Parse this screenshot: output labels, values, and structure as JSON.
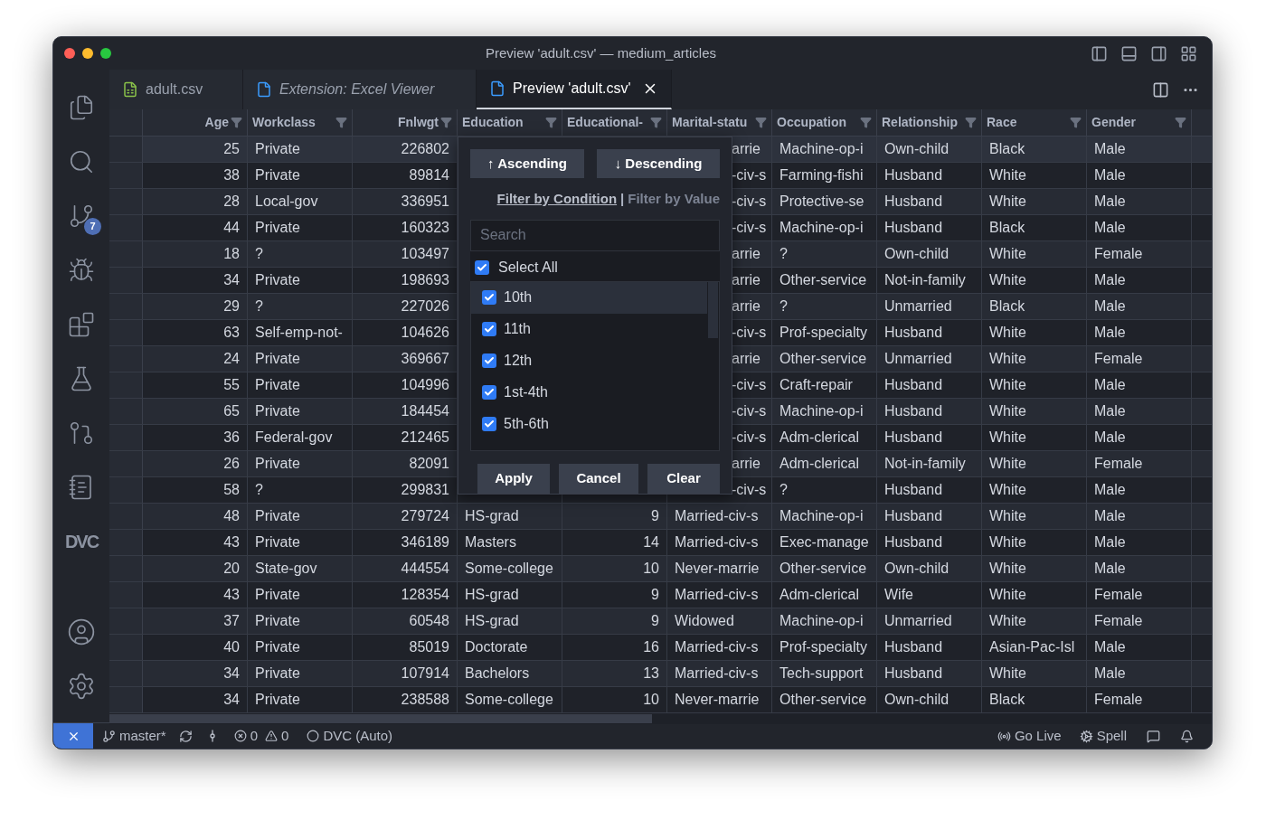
{
  "window": {
    "title": "Preview 'adult.csv' — medium_articles"
  },
  "activity_bar": {
    "source_control_badge": "7",
    "dvc_logo": "DVC"
  },
  "tabs": [
    {
      "label": "adult.csv",
      "kind": "spreadsheet",
      "italic": false,
      "selected": false
    },
    {
      "label": "Extension: Excel Viewer",
      "kind": "file",
      "italic": true,
      "selected": false
    },
    {
      "label": "Preview 'adult.csv'",
      "kind": "file",
      "italic": false,
      "selected": true
    }
  ],
  "grid": {
    "columns": [
      {
        "label": "Age",
        "numeric": true
      },
      {
        "label": "Workclass",
        "numeric": false
      },
      {
        "label": "Fnlwgt",
        "numeric": true
      },
      {
        "label": "Education",
        "numeric": false
      },
      {
        "label": "Educational-",
        "numeric": false
      },
      {
        "label": "Marital-statu",
        "numeric": false
      },
      {
        "label": "Occupation",
        "numeric": false
      },
      {
        "label": "Relationship",
        "numeric": false
      },
      {
        "label": "Race",
        "numeric": false
      },
      {
        "label": "Gender",
        "numeric": false
      }
    ],
    "rows": [
      {
        "selected": true,
        "covered": true,
        "cells": [
          "25",
          "Private",
          "226802",
          "arrie",
          "Machine-op-i",
          "Own-child",
          "Black",
          "Male"
        ]
      },
      {
        "selected": false,
        "covered": true,
        "cells": [
          "38",
          "Private",
          "89814",
          "-civ-s",
          "Farming-fishi",
          "Husband",
          "White",
          "Male"
        ]
      },
      {
        "selected": false,
        "covered": true,
        "cells": [
          "28",
          "Local-gov",
          "336951",
          "-civ-s",
          "Protective-se",
          "Husband",
          "White",
          "Male"
        ]
      },
      {
        "selected": false,
        "covered": true,
        "cells": [
          "44",
          "Private",
          "160323",
          "-civ-s",
          "Machine-op-i",
          "Husband",
          "Black",
          "Male"
        ]
      },
      {
        "selected": false,
        "covered": true,
        "cells": [
          "18",
          "?",
          "103497",
          "arrie",
          "?",
          "Own-child",
          "White",
          "Female"
        ]
      },
      {
        "selected": false,
        "covered": true,
        "cells": [
          "34",
          "Private",
          "198693",
          "arrie",
          "Other-service",
          "Not-in-family",
          "White",
          "Male"
        ]
      },
      {
        "selected": false,
        "covered": true,
        "cells": [
          "29",
          "?",
          "227026",
          "arrie",
          "?",
          "Unmarried",
          "Black",
          "Male"
        ]
      },
      {
        "selected": false,
        "covered": true,
        "cells": [
          "63",
          "Self-emp-not-",
          "104626",
          "-civ-s",
          "Prof-specialty",
          "Husband",
          "White",
          "Male"
        ]
      },
      {
        "selected": false,
        "covered": true,
        "cells": [
          "24",
          "Private",
          "369667",
          "arrie",
          "Other-service",
          "Unmarried",
          "White",
          "Female"
        ]
      },
      {
        "selected": false,
        "covered": true,
        "cells": [
          "55",
          "Private",
          "104996",
          "-civ-s",
          "Craft-repair",
          "Husband",
          "White",
          "Male"
        ]
      },
      {
        "selected": false,
        "covered": true,
        "cells": [
          "65",
          "Private",
          "184454",
          "-civ-s",
          "Machine-op-i",
          "Husband",
          "White",
          "Male"
        ]
      },
      {
        "selected": false,
        "covered": true,
        "cells": [
          "36",
          "Federal-gov",
          "212465",
          "-civ-s",
          "Adm-clerical",
          "Husband",
          "White",
          "Male"
        ]
      },
      {
        "selected": false,
        "covered": true,
        "cells": [
          "26",
          "Private",
          "82091",
          "arrie",
          "Adm-clerical",
          "Not-in-family",
          "White",
          "Female"
        ]
      },
      {
        "selected": false,
        "covered": true,
        "cells": [
          "58",
          "?",
          "299831",
          "-civ-s",
          "?",
          "Husband",
          "White",
          "Male"
        ]
      },
      {
        "selected": false,
        "covered": false,
        "cells": [
          "48",
          "Private",
          "279724",
          "HS-grad",
          "9",
          "Married-civ-s",
          "Machine-op-i",
          "Husband",
          "White",
          "Male"
        ]
      },
      {
        "selected": false,
        "covered": false,
        "cells": [
          "43",
          "Private",
          "346189",
          "Masters",
          "14",
          "Married-civ-s",
          "Exec-manage",
          "Husband",
          "White",
          "Male"
        ]
      },
      {
        "selected": false,
        "covered": false,
        "cells": [
          "20",
          "State-gov",
          "444554",
          "Some-college",
          "10",
          "Never-marrie",
          "Other-service",
          "Own-child",
          "White",
          "Male"
        ]
      },
      {
        "selected": false,
        "covered": false,
        "cells": [
          "43",
          "Private",
          "128354",
          "HS-grad",
          "9",
          "Married-civ-s",
          "Adm-clerical",
          "Wife",
          "White",
          "Female"
        ]
      },
      {
        "selected": false,
        "covered": false,
        "cells": [
          "37",
          "Private",
          "60548",
          "HS-grad",
          "9",
          "Widowed",
          "Machine-op-i",
          "Unmarried",
          "White",
          "Female"
        ]
      },
      {
        "selected": false,
        "covered": false,
        "cells": [
          "40",
          "Private",
          "85019",
          "Doctorate",
          "16",
          "Married-civ-s",
          "Prof-specialty",
          "Husband",
          "Asian-Pac-Isl",
          "Male"
        ]
      },
      {
        "selected": false,
        "covered": false,
        "cells": [
          "34",
          "Private",
          "107914",
          "Bachelors",
          "13",
          "Married-civ-s",
          "Tech-support",
          "Husband",
          "White",
          "Male"
        ]
      },
      {
        "selected": false,
        "covered": false,
        "cells": [
          "34",
          "Private",
          "238588",
          "Some-college",
          "10",
          "Never-marrie",
          "Other-service",
          "Own-child",
          "Black",
          "Female"
        ]
      }
    ]
  },
  "filter_popup": {
    "sort_buttons": [
      "↑ Ascending",
      "↓ Descending"
    ],
    "modes": [
      {
        "label": "Filter by Condition",
        "selected": false
      },
      {
        "label": "Filter by Value",
        "selected": true
      }
    ],
    "mode_separator": "|",
    "search": {
      "placeholder": "Search"
    },
    "select_all": {
      "label": "Select All",
      "checked": true
    },
    "values": [
      {
        "label": "10th",
        "checked": true,
        "selected": true
      },
      {
        "label": "11th",
        "checked": true,
        "selected": false
      },
      {
        "label": "12th",
        "checked": true,
        "selected": false
      },
      {
        "label": "1st-4th",
        "checked": true,
        "selected": false
      },
      {
        "label": "5th-6th",
        "checked": true,
        "selected": false
      }
    ],
    "buttons": [
      "Apply",
      "Cancel",
      "Clear"
    ]
  },
  "status_bar": {
    "branch": "master*",
    "errors": "0",
    "warnings": "0",
    "dvc": "DVC (Auto)",
    "go_live": "Go Live",
    "spell": "Spell"
  }
}
